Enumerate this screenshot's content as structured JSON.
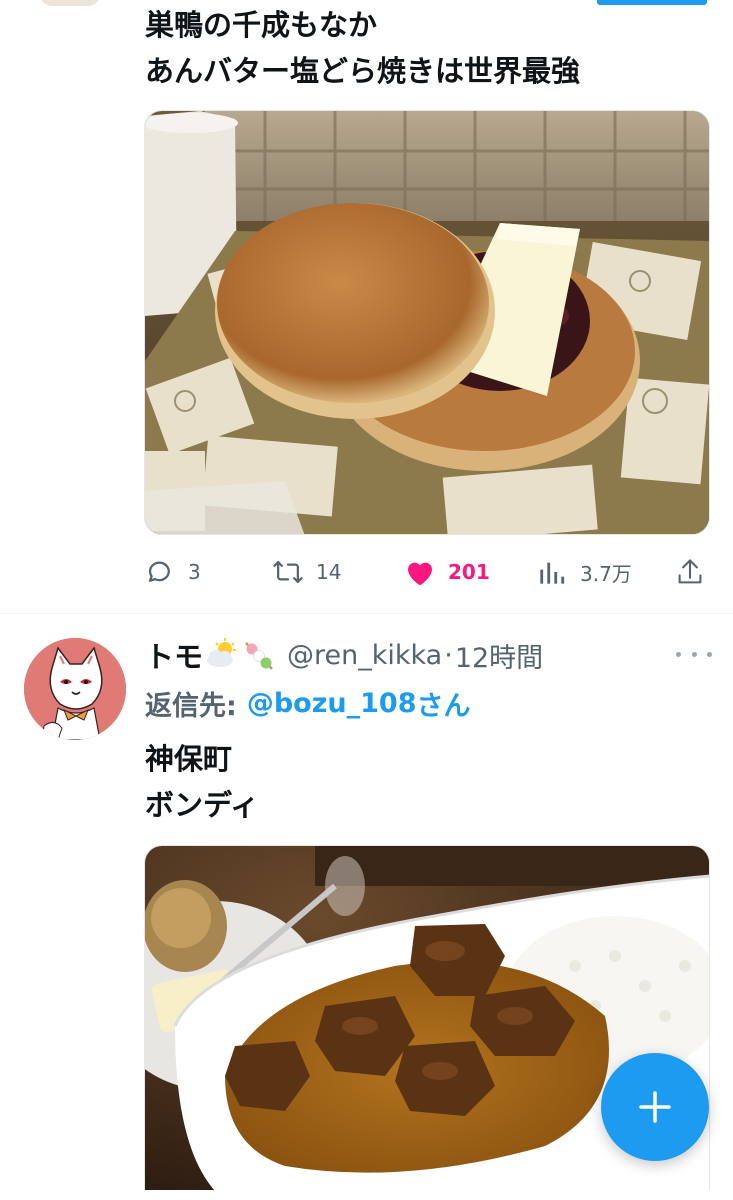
{
  "tweet1": {
    "text_lines": [
      "巣鴨の千成もなか",
      "あんバター塩どら焼きは世界最強"
    ],
    "media": {
      "description_icon": "dorayaki-photo"
    },
    "actions": {
      "reply_count": "3",
      "retweet_count": "14",
      "like_count": "201",
      "view_count": "3.7万",
      "liked": true
    }
  },
  "tweet2": {
    "display_name": "トモ",
    "name_emojis": [
      "sun-behind-cloud-emoji",
      "dango-emoji"
    ],
    "handle": "@ren_kikka",
    "separator": "·",
    "time": "12時間",
    "reply_to": {
      "prefix": "返信先:",
      "user": "@bozu_108",
      "suffix": "さん"
    },
    "text_lines": [
      "神保町",
      "ボンディ"
    ],
    "media": {
      "description_icon": "beef-curry-photo"
    }
  },
  "fab": {
    "icon": "plus-icon",
    "label": "+"
  },
  "colors": {
    "accent": "#1d9bf0",
    "like": "#f91880",
    "secondary_text": "#536471",
    "primary_text": "#0f1419"
  }
}
